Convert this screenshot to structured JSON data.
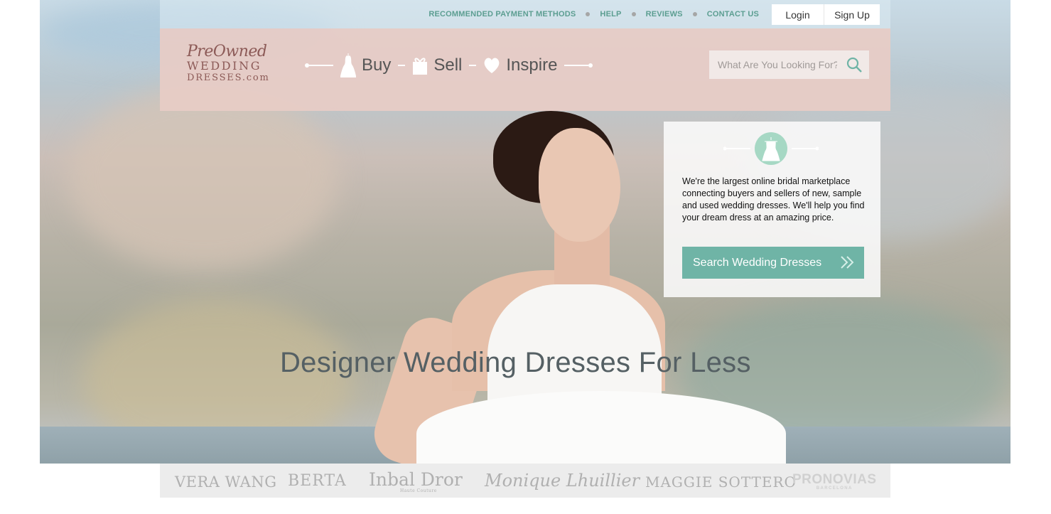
{
  "top_links": {
    "payment": "RECOMMENDED PAYMENT METHODS",
    "help": "HELP",
    "reviews": "REVIEWS",
    "contact": "CONTACT US"
  },
  "auth": {
    "login": "Login",
    "signup": "Sign Up"
  },
  "logo": {
    "line1": "PreOwned",
    "line2": "WEDDING",
    "line3": "DRESSES.com"
  },
  "nav": {
    "buy": "Buy",
    "sell": "Sell",
    "inspire": "Inspire"
  },
  "search": {
    "placeholder": "What Are You Looking For?"
  },
  "intro": {
    "text": "We're the largest online bridal marketplace connecting buyers and sellers of new, sample and used wedding dresses. We'll help you find your dream dress at an amazing price.",
    "cta": "Search Wedding Dresses"
  },
  "headline": "Designer Wedding Dresses For Less",
  "brands": {
    "vera": "VERA WANG",
    "berta": "BERTA",
    "inbal": "Inbal Dror",
    "inbal_sub": "Haute Couture",
    "monique": "Monique Lhuillier",
    "maggie": "MAGGIE SOTTERO",
    "pronovias": "PRONOVIAS",
    "pronovias_sub": "BARCELONA"
  },
  "colors": {
    "accent": "#6fb4a6",
    "header": "#e8ccc6",
    "link": "#5c9e91"
  },
  "icons": [
    "dress-icon",
    "gift-icon",
    "heart-icon",
    "search-icon",
    "hanger-dress-icon",
    "double-chevron-icon"
  ]
}
